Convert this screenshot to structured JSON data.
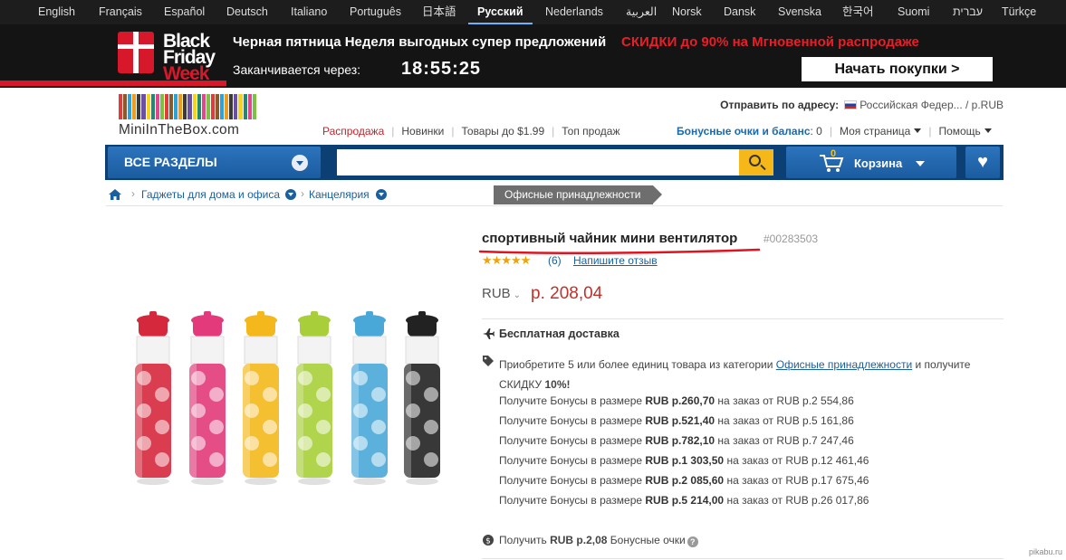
{
  "languages": [
    "English",
    "Français",
    "Español",
    "Deutsch",
    "Italiano",
    "Português",
    "日本語",
    "Русский",
    "Nederlands",
    "العربية",
    "Norsk",
    "Dansk",
    "Svenska",
    "한국어",
    "Suomi",
    "עברית",
    "Türkçe"
  ],
  "active_language": "Русский",
  "banner": {
    "logo": [
      "Black",
      "Friday",
      "Week"
    ],
    "title": "Черная пятница Неделя выгодных супер предложений",
    "sale": "СКИДКИ до 90% на Мгновенной распродаже",
    "ends_label": "Заканчивается через:",
    "timer": "18:55:25",
    "cta": "Начать покупки >",
    "colors": {
      "accent": "#d7182a",
      "background": "#141414"
    }
  },
  "header": {
    "logo_text": "MiniInTheBox.com",
    "ship_label": "Отправить по адресу:",
    "ship_value": "Российская Федер... / р.RUB",
    "nav": [
      "Распродажа",
      "Новинки",
      "Товары до $1.99",
      "Топ продаж"
    ],
    "bonus_label": "Бонусные очки и баланс",
    "bonus_value": ": 0",
    "my_page": "Моя страница",
    "help": "Помощь"
  },
  "toolbar": {
    "all_categories": "ВСЕ РАЗДЕЛЫ",
    "search_placeholder": "",
    "cart_label": "Корзина",
    "cart_count": "0",
    "colors": {
      "bar": "#0c3f73",
      "search_button": "#f5b818"
    }
  },
  "breadcrumb": {
    "items": [
      "Гаджеты для дома и офиса",
      "Канцелярия"
    ],
    "current": "Офисные принадлежности"
  },
  "product": {
    "title": "спортивный чайник мини вентилятор",
    "sku": "#00283503",
    "stars": "★★★★★",
    "rating_count": "(6)",
    "review_link": "Напишите отзыв",
    "currency": "RUB",
    "price": "р. 208,04",
    "free_shipping": "Бесплатная доставка",
    "promo_pre": "Приобретите 5 или более единиц товара из категории ",
    "promo_link": "Офисные принадлежности",
    "promo_post": " и получите СКИДКУ ",
    "promo_discount": "10%!",
    "bonuses": [
      {
        "pre": "Получите Бонусы в размере ",
        "amount": "RUB р.260,70",
        "post": " на заказ от RUB р.2 554,86"
      },
      {
        "pre": "Получите Бонусы в размере ",
        "amount": "RUB р.521,40",
        "post": " на заказ от RUB р.5 161,86"
      },
      {
        "pre": "Получите Бонусы в размере ",
        "amount": "RUB р.782,10",
        "post": " на заказ от RUB р.7 247,46"
      },
      {
        "pre": "Получите Бонусы в размере ",
        "amount": "RUB р.1 303,50",
        "post": " на заказ от RUB р.12 461,46"
      },
      {
        "pre": "Получите Бонусы в размере ",
        "amount": "RUB р.2 085,60",
        "post": " на заказ от RUB р.17 675,46"
      },
      {
        "pre": "Получите Бонусы в размере ",
        "amount": "RUB р.5 214,00",
        "post": " на заказ от RUB р.26 017,86"
      }
    ],
    "get_pre": "Получить ",
    "get_amount": "RUB р.2,08",
    "get_post": " Бонусные очки",
    "bottle_colors": [
      "#d6283c",
      "#e23a7a",
      "#f4b81c",
      "#a8cf3a",
      "#4aa8d8",
      "#222222"
    ]
  },
  "watermark": "pikabu.ru"
}
